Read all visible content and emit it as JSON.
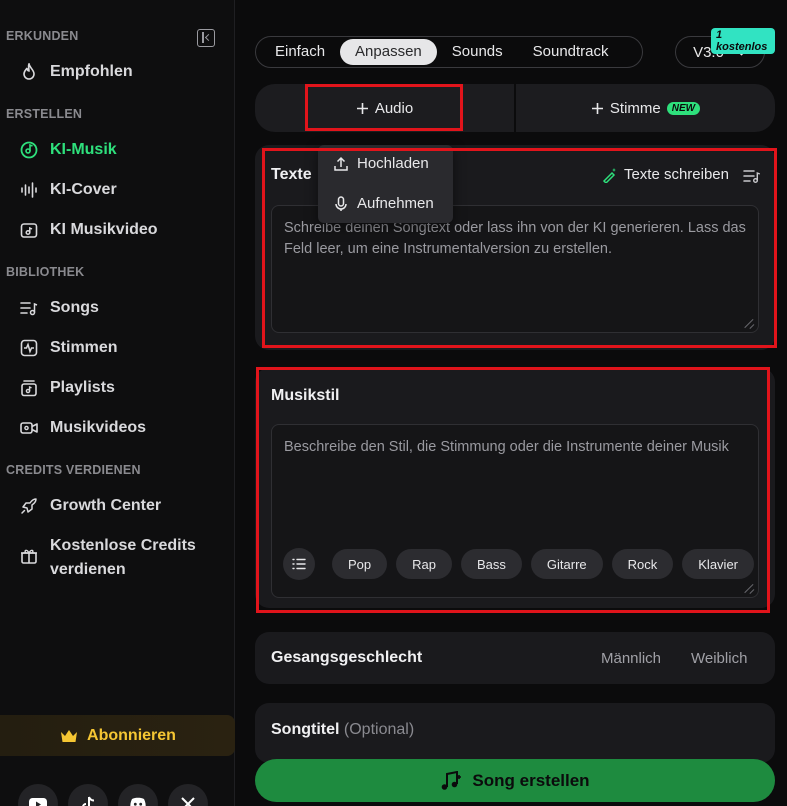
{
  "sidebar": {
    "sections": {
      "explore": "ERKUNDEN",
      "create": "ERSTELLEN",
      "library": "BIBLIOTHEK",
      "credits": "CREDITS VERDIENEN"
    },
    "items": {
      "recommended": "Empfohlen",
      "ai_music": "KI-Musik",
      "ai_cover": "KI-Cover",
      "ai_video": "KI Musikvideo",
      "songs": "Songs",
      "voices": "Stimmen",
      "playlists": "Playlists",
      "music_videos": "Musikvideos",
      "growth_center": "Growth Center",
      "free_credits_line1": "Kostenlose Credits",
      "free_credits_line2": "verdienen"
    },
    "subscribe": "Abonnieren",
    "accent_color": "#2ee07c",
    "gold_color": "#f5c633"
  },
  "header": {
    "tabs": [
      "Einfach",
      "Anpassen",
      "Sounds",
      "Soundtrack"
    ],
    "active_tab": "Anpassen",
    "version": "V3.0",
    "free_badge": "1 kostenlos"
  },
  "actions": {
    "audio": "Audio",
    "voice": "Stimme",
    "new_badge": "NEW"
  },
  "dropdown": {
    "upload": "Hochladen",
    "record": "Aufnehmen"
  },
  "lyrics": {
    "title": "Texte",
    "write_button": "Texte schreiben",
    "placeholder": "Schreibe deinen Songtext oder lass ihn von der KI generieren. Lass das Feld leer, um eine Instrumentalversion zu erstellen."
  },
  "style": {
    "title": "Musikstil",
    "placeholder": "Beschreibe den Stil, die Stimmung oder die Instrumente deiner Musik",
    "chips": [
      "Pop",
      "Rap",
      "Bass",
      "Gitarre",
      "Rock",
      "Klavier"
    ]
  },
  "gender": {
    "title": "Gesangsgeschlecht",
    "male": "Männlich",
    "female": "Weiblich"
  },
  "song_title": {
    "title": "Songtitel",
    "optional": "(Optional)"
  },
  "create_button": "Song erstellen"
}
